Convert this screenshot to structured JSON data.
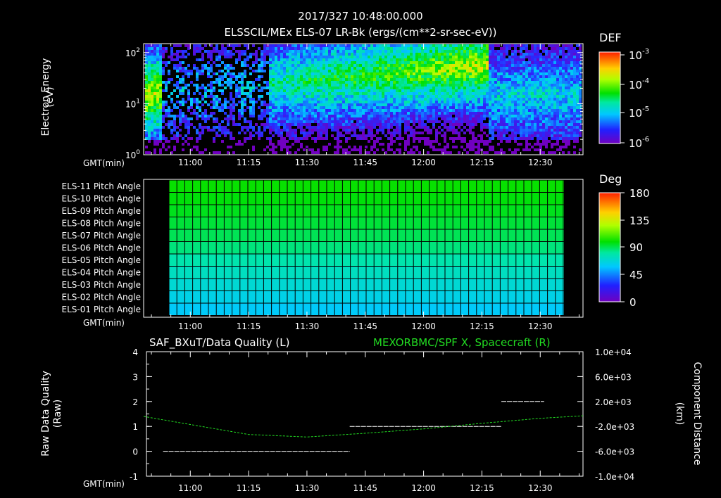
{
  "header": {
    "datetime": "2017/327 10:48:00.000",
    "subtitle": "ELSSCIL/MEx ELS-07 LR-Bk   (ergs/(cm**2-sr-sec-eV))"
  },
  "panels": {
    "spectrogram": {
      "ylabel_line1": "Electron Energy",
      "ylabel_line2": "(eV)",
      "colorbar_title": "DEF",
      "colorbar_ticks": [
        "10-3",
        "10-4",
        "10-5",
        "10-6"
      ]
    },
    "pitch": {
      "colorbar_title": "Deg",
      "colorbar_ticks": [
        "180",
        "135",
        "90",
        "45",
        "0"
      ]
    },
    "timeseries": {
      "left_title": "SAF_BXuT/Data Quality (L)",
      "right_title": "MEXORBMC/SPF X, Spacecraft (R)",
      "ylabel_left_line1": "Raw Data Quality",
      "ylabel_left_line2": "(Raw)",
      "ylabel_right_line1": "Component Distance",
      "ylabel_right_line2": "(km)"
    },
    "gmt_label": "GMT(min)"
  },
  "colors": {
    "background": "#000000",
    "orbit_line": "#22dd22",
    "quality_line": "#ffffff",
    "right_title": "#22dd22"
  },
  "chart_data": [
    {
      "type": "heatmap",
      "title": "ELSSCIL/MEx ELS-07 LR-Bk   (ergs/(cm**2-sr-sec-eV))",
      "xlabel": "GMT(min)",
      "ylabel": "Electron Energy (eV)",
      "x_ticks": [
        "11:00",
        "11:15",
        "11:30",
        "11:45",
        "12:00",
        "12:15",
        "12:30"
      ],
      "y_ticks": [
        "10^0",
        "10^1",
        "10^2"
      ],
      "yscale": "log",
      "ylim": [
        1,
        150
      ],
      "colorbar": {
        "label": "DEF",
        "ticks": [
          "10^-3",
          "10^-4",
          "10^-5",
          "10^-6"
        ],
        "scale": "log"
      }
    },
    {
      "type": "heatmap",
      "title": "Pitch Angle",
      "xlabel": "GMT(min)",
      "x_ticks": [
        "11:00",
        "11:15",
        "11:30",
        "11:45",
        "12:00",
        "12:15",
        "12:30"
      ],
      "rows": [
        "ELS-11 Pitch Angle",
        "ELS-10 Pitch Angle",
        "ELS-09 Pitch Angle",
        "ELS-08 Pitch Angle",
        "ELS-07 Pitch Angle",
        "ELS-06 Pitch Angle",
        "ELS-05 Pitch Angle",
        "ELS-04 Pitch Angle",
        "ELS-03 Pitch Angle",
        "ELS-02 Pitch Angle",
        "ELS-01 Pitch Angle"
      ],
      "row_values_deg": [
        100,
        98,
        96,
        93,
        90,
        86,
        80,
        74,
        68,
        62,
        56
      ],
      "colorbar": {
        "label": "Deg",
        "ticks": [
          180,
          135,
          90,
          45,
          0
        ],
        "range": [
          0,
          180
        ]
      }
    },
    {
      "type": "line",
      "xlabel": "GMT(min)",
      "x_ticks": [
        "11:00",
        "11:15",
        "11:30",
        "11:45",
        "12:00",
        "12:15",
        "12:30"
      ],
      "y_left": {
        "label": "Raw Data Quality (Raw)",
        "ticks": [
          "4",
          "3",
          "2",
          "1",
          "0",
          "-1"
        ],
        "range": [
          -1,
          4
        ]
      },
      "y_right": {
        "label": "Component Distance (km)",
        "ticks": [
          "1.0e+04",
          "6.0e+03",
          "2.0e+03",
          "-2.0e+03",
          "-6.0e+03",
          "-1.0e+04"
        ],
        "range": [
          -10000,
          10000
        ]
      },
      "series": [
        {
          "name": "SAF_BXuT/Data Quality (L)",
          "axis": "left",
          "x": [
            "10:53",
            "11:41",
            "11:41",
            "12:20",
            "12:20",
            "12:31"
          ],
          "y": [
            0,
            0,
            1,
            1,
            2,
            2
          ]
        },
        {
          "name": "MEXORBMC/SPF X, Spacecraft (R)",
          "axis": "right",
          "x": [
            "10:48",
            "11:00",
            "11:15",
            "11:30",
            "11:45",
            "12:00",
            "12:15",
            "12:30",
            "12:41"
          ],
          "y": [
            -400,
            -1700,
            -3300,
            -3700,
            -3100,
            -2400,
            -1500,
            -700,
            -300
          ]
        }
      ]
    }
  ]
}
